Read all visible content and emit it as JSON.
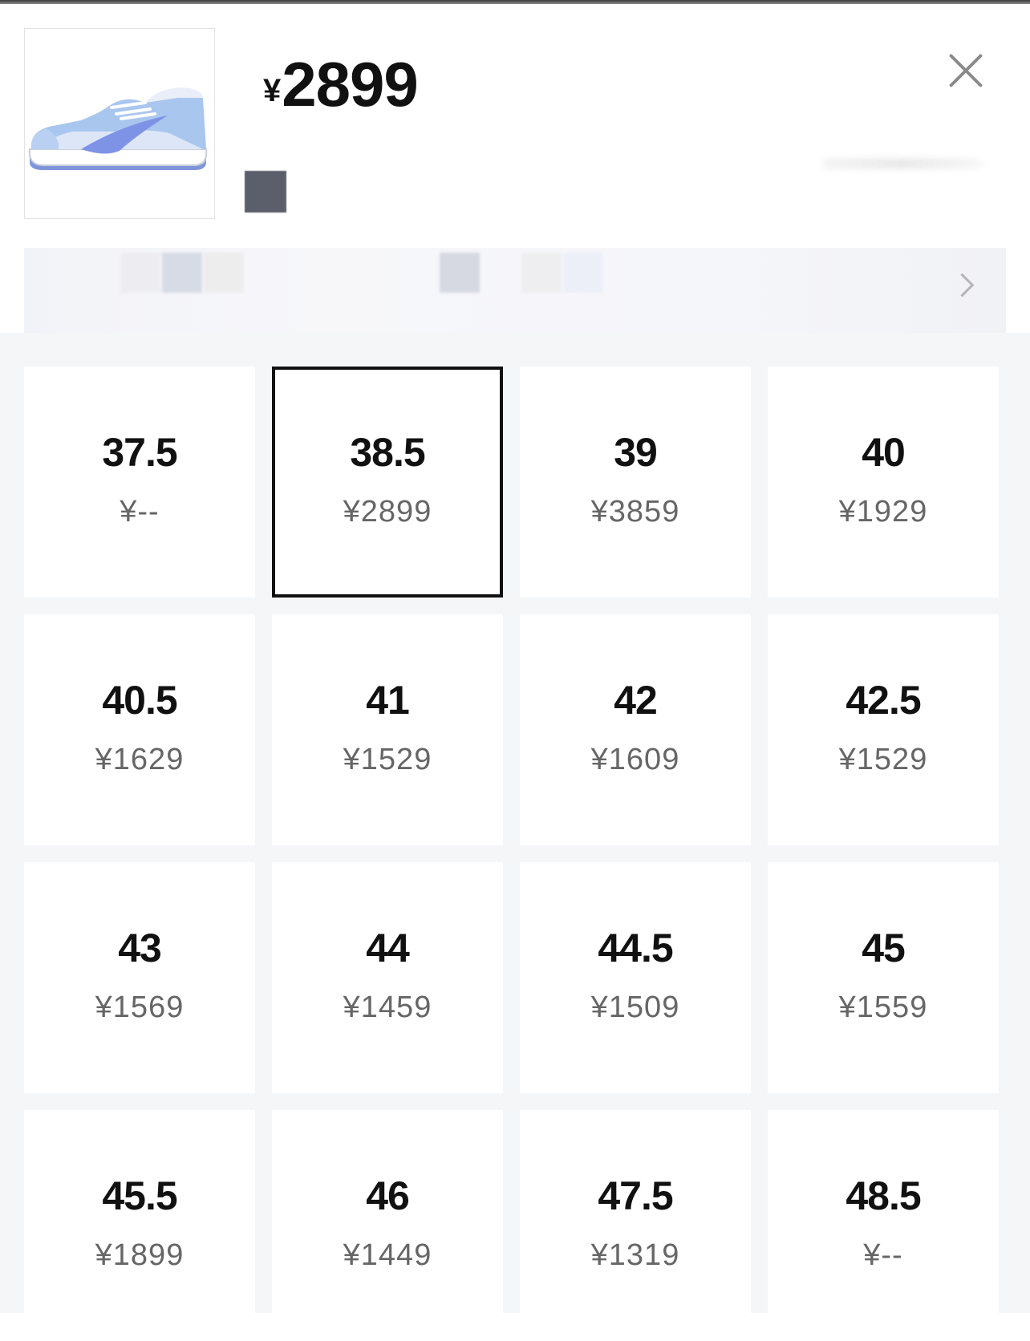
{
  "header": {
    "currency_symbol": "¥",
    "price": "2899"
  },
  "sizes": [
    {
      "size": "37.5",
      "price": "¥--"
    },
    {
      "size": "38.5",
      "price": "¥2899",
      "selected": true
    },
    {
      "size": "39",
      "price": "¥3859"
    },
    {
      "size": "40",
      "price": "¥1929"
    },
    {
      "size": "40.5",
      "price": "¥1629"
    },
    {
      "size": "41",
      "price": "¥1529"
    },
    {
      "size": "42",
      "price": "¥1609"
    },
    {
      "size": "42.5",
      "price": "¥1529"
    },
    {
      "size": "43",
      "price": "¥1569"
    },
    {
      "size": "44",
      "price": "¥1459"
    },
    {
      "size": "44.5",
      "price": "¥1509"
    },
    {
      "size": "45",
      "price": "¥1559"
    },
    {
      "size": "45.5",
      "price": "¥1899"
    },
    {
      "size": "46",
      "price": "¥1449"
    },
    {
      "size": "47.5",
      "price": "¥1319"
    },
    {
      "size": "48.5",
      "price": "¥--"
    }
  ]
}
